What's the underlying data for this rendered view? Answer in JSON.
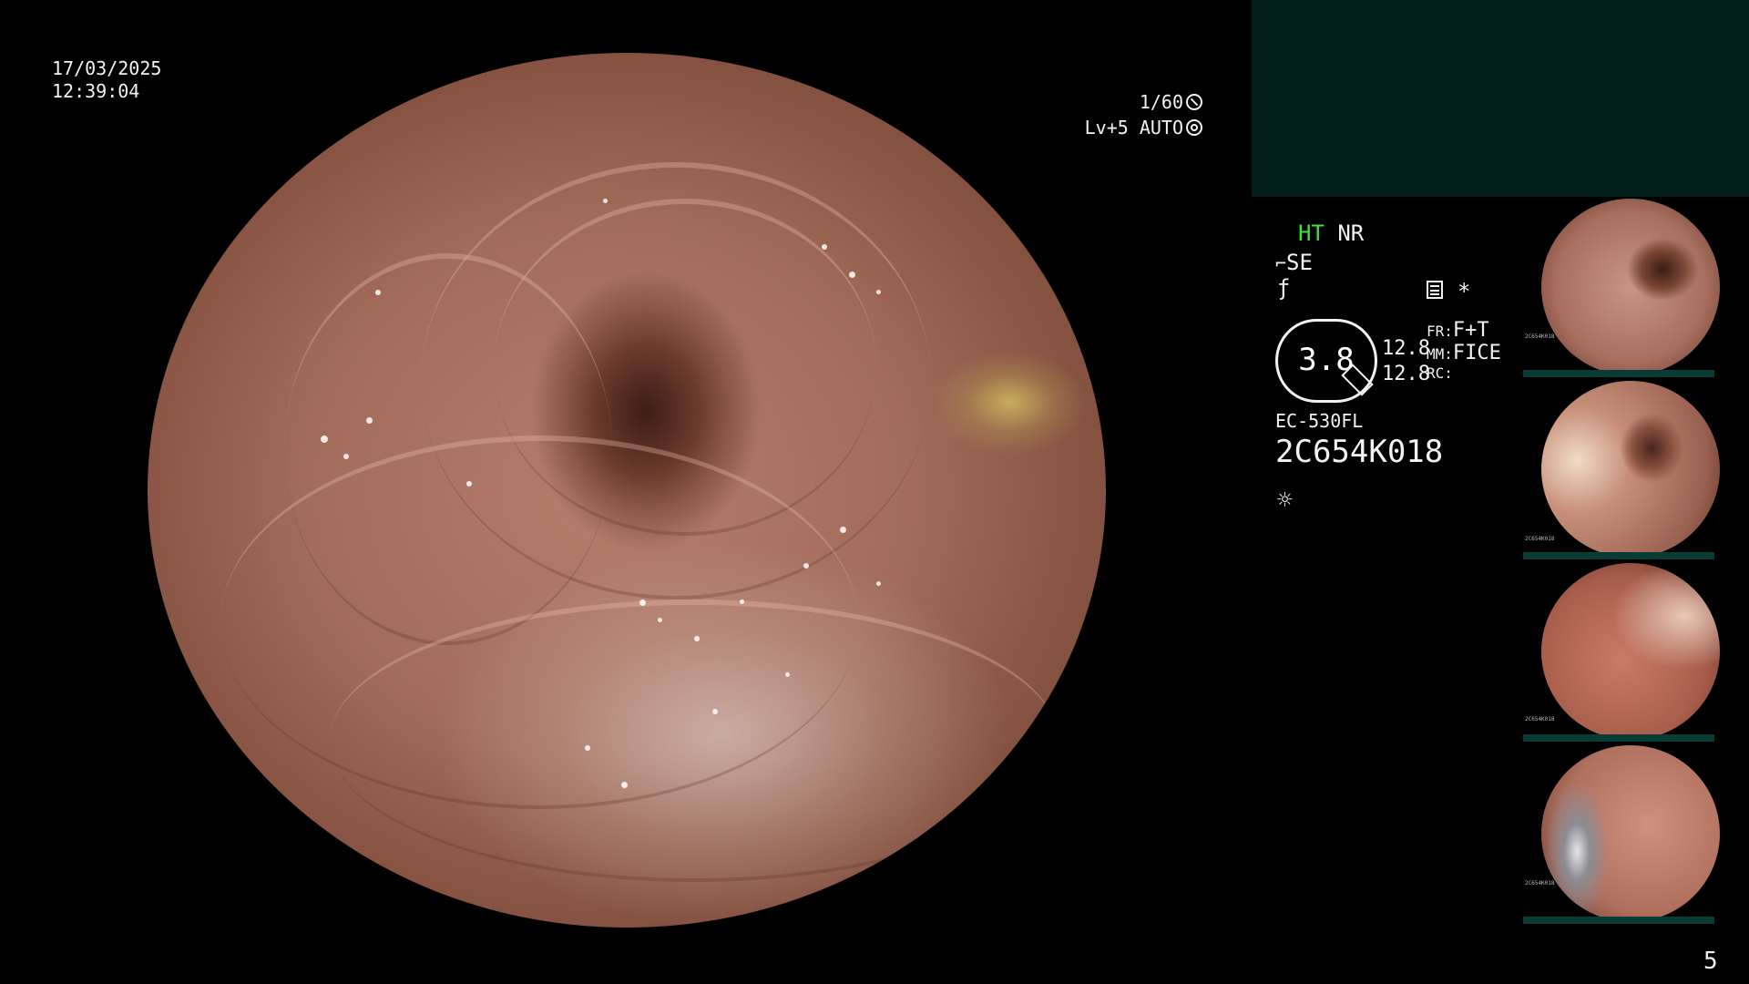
{
  "datetime": {
    "date": "17/03/2025",
    "time": "12:39:04"
  },
  "scope_info": {
    "shutter": "1/60",
    "level": "Lv+5",
    "iris_mode": "AUTO"
  },
  "panel": {
    "ht": "HT",
    "nr": "NR",
    "se": "SE",
    "asterisk": "*",
    "brightness": "3.8",
    "val1": "12.8",
    "val2": "12.8",
    "fr_label": "FR:",
    "fr_value": "F+T",
    "mm_label": "MM:",
    "mm_value": "FICE",
    "rc_label": "RC:",
    "scope_model": "EC-530FL",
    "serial": "2C654K018"
  },
  "thumbnails": [
    {
      "label": "2C654K018",
      "tone": "#b07868"
    },
    {
      "label": "2C654K018",
      "tone": "#c28a74"
    },
    {
      "label": "2C654K018",
      "tone": "#b8705c"
    },
    {
      "label": "2C654K018",
      "tone": "#c0826e"
    }
  ],
  "page_number": "5"
}
